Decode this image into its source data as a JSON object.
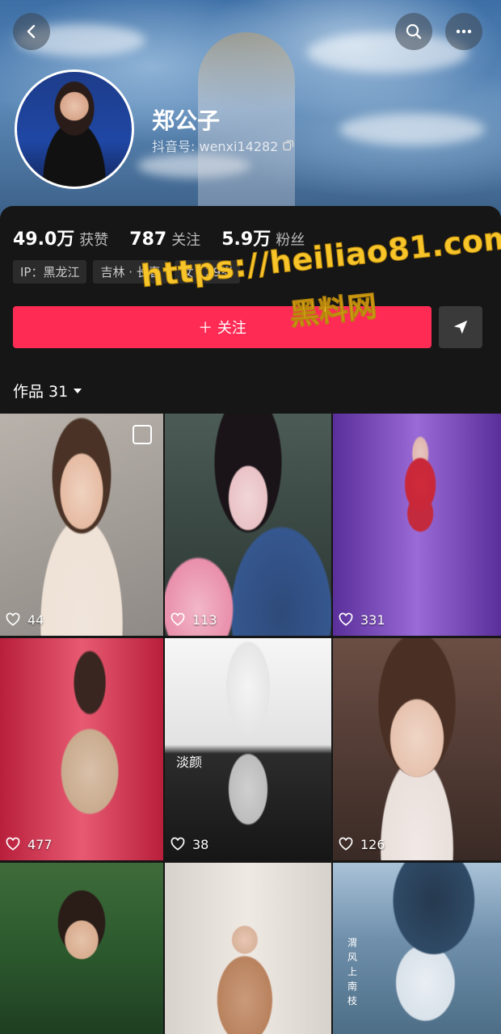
{
  "profile": {
    "name": "郑公子",
    "handle": "抖音号: wenxi14282"
  },
  "stats": [
    {
      "num": "49.0万",
      "label": "获赞"
    },
    {
      "num": "787",
      "label": "关注"
    },
    {
      "num": "5.9万",
      "label": "粉丝"
    }
  ],
  "tags": [
    "IP：黑龙江",
    "吉林 · 长春",
    "女 · 29岁"
  ],
  "actions": {
    "follow_label": "＋ 关注"
  },
  "watermark": {
    "url": "https://heiliao81.com",
    "name": "黑料网"
  },
  "works": {
    "label": "作品 31"
  },
  "videos": [
    {
      "likes": "44"
    },
    {
      "likes": "113"
    },
    {
      "likes": "331"
    },
    {
      "likes": "477"
    },
    {
      "likes": "38",
      "caption": "淡颜"
    },
    {
      "likes": "126"
    },
    {
      "likes": ""
    },
    {
      "likes": ""
    },
    {
      "likes": "",
      "vertical_text": "渭风上南枝"
    }
  ],
  "colors": {
    "accent": "#fe2c55",
    "background": "#161616"
  }
}
